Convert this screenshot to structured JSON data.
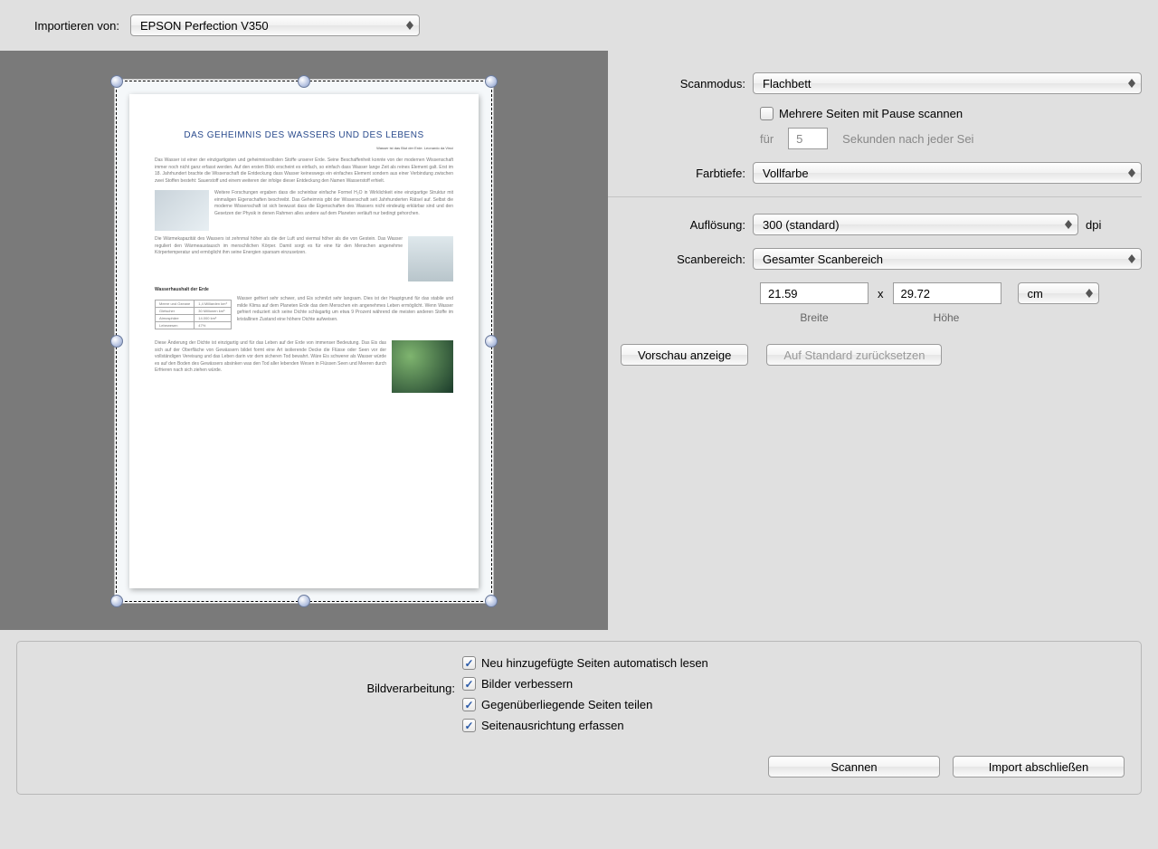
{
  "top": {
    "import_label": "Importieren von:",
    "scanner": "EPSON Perfection V350"
  },
  "preview": {
    "doc_title": "DAS GEHEIMNIS DES WASSERS UND DES LEBENS",
    "doc_subtitle": "Wasser ist das Blut der Erde. Leonardo da Vinci",
    "section_heading": "Wasserhaushalt der Erde",
    "table": [
      [
        "Meere und Ozeane",
        "1,4 Milliarden km³"
      ],
      [
        "Gletscher",
        "30 Millionen km³"
      ],
      [
        "Atmosphäre",
        "14.000 km³"
      ],
      [
        "Lebewesen",
        "47%"
      ]
    ]
  },
  "settings": {
    "scanmode_label": "Scanmodus:",
    "scanmode_value": "Flachbett",
    "multipage_label": "Mehrere Seiten mit Pause scannen",
    "multipage_checked": false,
    "pause_prefix": "für",
    "pause_value": "5",
    "pause_suffix": "Sekunden nach jeder Sei",
    "colordepth_label": "Farbtiefe:",
    "colordepth_value": "Vollfarbe",
    "resolution_label": "Auflösung:",
    "resolution_value": "300 (standard)",
    "resolution_unit": "dpi",
    "scanarea_label": "Scanbereich:",
    "scanarea_value": "Gesamter Scanbereich",
    "width_value": "21.59",
    "height_value": "29.72",
    "dim_sep": "x",
    "unit_value": "cm",
    "width_caption": "Breite",
    "height_caption": "Höhe",
    "preview_btn": "Vorschau anzeige",
    "reset_btn": "Auf Standard zurücksetzen"
  },
  "bottom": {
    "processing_label": "Bildverarbeitung:",
    "opts": [
      {
        "label": "Neu hinzugefügte Seiten automatisch lesen",
        "checked": true
      },
      {
        "label": "Bilder verbessern",
        "checked": true
      },
      {
        "label": "Gegenüberliegende Seiten teilen",
        "checked": true
      },
      {
        "label": "Seitenausrichtung erfassen",
        "checked": true
      }
    ],
    "scan_btn": "Scannen",
    "finish_btn": "Import abschließen"
  }
}
